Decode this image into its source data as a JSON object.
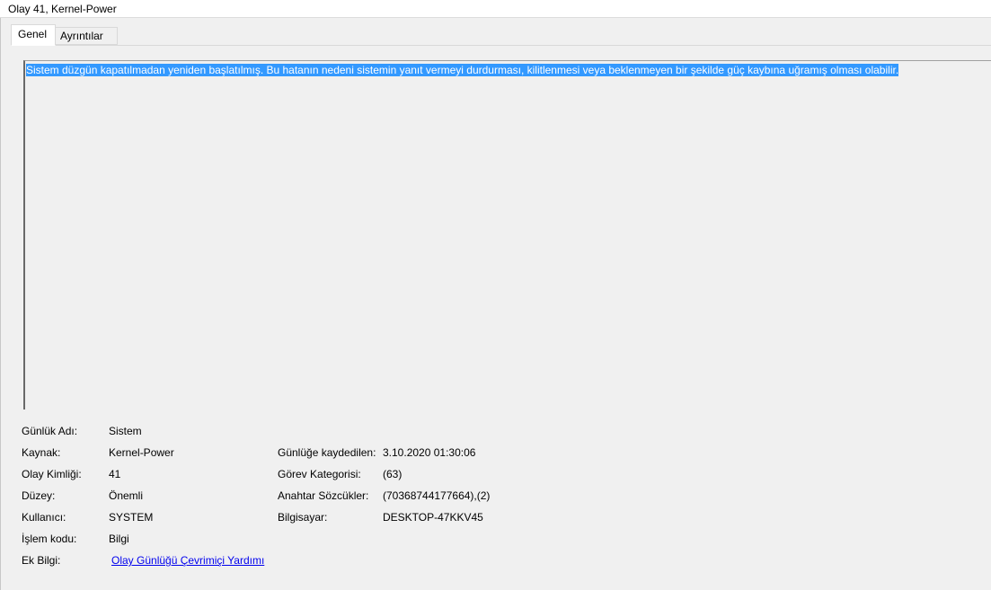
{
  "window": {
    "title": "Olay 41, Kernel-Power"
  },
  "tabs": [
    {
      "label": "Genel",
      "active": true
    },
    {
      "label": "Ayrıntılar",
      "active": false
    }
  ],
  "message": {
    "text": "Sistem düzgün kapatılmadan yeniden başlatılmış. Bu hatanın nedeni sistemin yanıt vermeyi durdurması, kilitlenmesi veya beklenmeyen bir şekilde güç kaybına uğramış olması olabilir.",
    "selected": true,
    "selection_color": "#3399ff"
  },
  "details": {
    "log_name_label": "Günlük Adı:",
    "log_name_value": "Sistem",
    "source_label": "Kaynak:",
    "source_value": "Kernel-Power",
    "logged_label": "Günlüğe kaydedilen:",
    "logged_value": "3.10.2020 01:30:06",
    "event_id_label": "Olay Kimliği:",
    "event_id_value": "41",
    "task_category_label": "Görev Kategorisi:",
    "task_category_value": "(63)",
    "level_label": "Düzey:",
    "level_value": "Önemli",
    "keywords_label": "Anahtar Sözcükler:",
    "keywords_value": "(70368744177664),(2)",
    "user_label": "Kullanıcı:",
    "user_value": "SYSTEM",
    "computer_label": "Bilgisayar:",
    "computer_value": "DESKTOP-47KKV45",
    "opcode_label": "İşlem kodu:",
    "opcode_value": "Bilgi",
    "more_info_label": "Ek Bilgi:",
    "more_info_link": "Olay Günlüğü Çevrimiçi Yardımı"
  }
}
